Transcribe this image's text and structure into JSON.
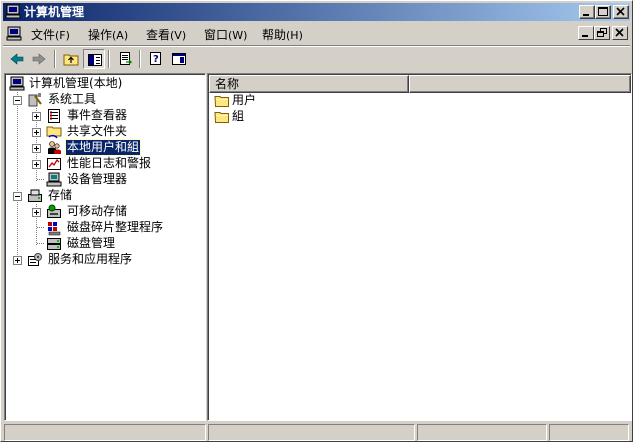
{
  "window": {
    "title": "计算机管理"
  },
  "menubar": {
    "items": [
      {
        "label": "文件",
        "hotkey": "(F)"
      },
      {
        "label": "操作",
        "hotkey": "(A)"
      },
      {
        "label": "查看",
        "hotkey": "(V)"
      },
      {
        "label": "窗口",
        "hotkey": "(W)"
      },
      {
        "label": "帮助",
        "hotkey": "(H)"
      }
    ]
  },
  "toolbar": {
    "buttons": [
      "back-icon",
      "forward-icon",
      "up-folder-icon",
      "show-hide-tree-icon",
      "export-list-icon",
      "help-icon",
      "properties-icon"
    ]
  },
  "tree": {
    "root": "计算机管理(本地)",
    "nodes": [
      {
        "label": "系统工具",
        "icon": "tools-icon",
        "expanded": true
      },
      {
        "label": "事件查看器",
        "icon": "event-viewer-icon",
        "expanded": false
      },
      {
        "label": "共享文件夹",
        "icon": "shared-folder-icon",
        "expanded": false
      },
      {
        "label": "本地用户和組",
        "icon": "users-groups-icon",
        "expanded": false,
        "selected": true
      },
      {
        "label": "性能日志和警报",
        "icon": "performance-log-icon",
        "expanded": false
      },
      {
        "label": "设备管理器",
        "icon": "device-manager-icon"
      },
      {
        "label": "存储",
        "icon": "storage-icon",
        "expanded": true
      },
      {
        "label": "可移动存储",
        "icon": "removable-storage-icon",
        "expanded": false
      },
      {
        "label": "磁盘碎片整理程序",
        "icon": "defrag-icon"
      },
      {
        "label": "磁盘管理",
        "icon": "disk-management-icon"
      },
      {
        "label": "服务和应用程序",
        "icon": "services-apps-icon",
        "expanded": false
      }
    ]
  },
  "list": {
    "columns": [
      "名称"
    ],
    "items": [
      {
        "label": "用户",
        "icon": "folder-icon"
      },
      {
        "label": "組",
        "icon": "folder-icon"
      }
    ]
  },
  "colors": {
    "titlebar_start": "#0a246a",
    "titlebar_end": "#a6caf0",
    "selection": "#0a246a",
    "face": "#d4d0c8"
  }
}
